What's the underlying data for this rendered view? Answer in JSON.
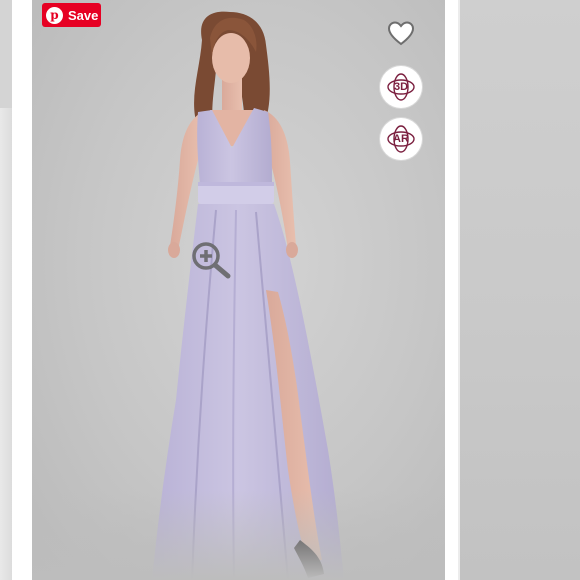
{
  "pin_button": {
    "label": "Save",
    "icon": "pinterest-p-icon",
    "color": "#e60023"
  },
  "actions": {
    "favorite_icon": "heart-icon",
    "view_3d_label": "3D",
    "view_ar_label": "AR",
    "accent_color": "#7b1f3f"
  },
  "image": {
    "subject": "lavender-dress-model",
    "zoom_icon": "zoom-in-icon",
    "dress_color": "#c8c2e0"
  }
}
